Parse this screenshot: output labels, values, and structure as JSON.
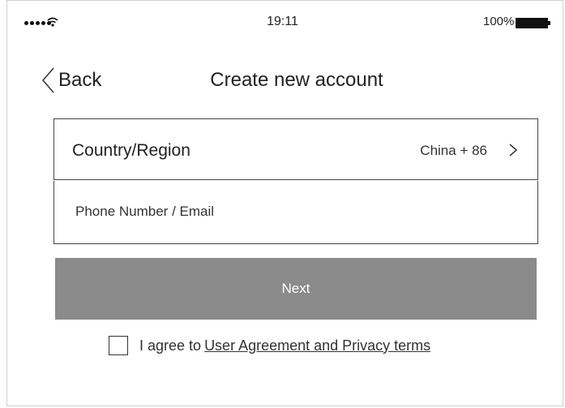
{
  "status_bar": {
    "time": "19:11",
    "battery_percent": "100%",
    "signal_bars": 5
  },
  "nav": {
    "back_label": "Back",
    "title": "Create new account"
  },
  "form": {
    "country_label": "Country/Region",
    "country_value": "China + 86",
    "phone_placeholder": "Phone Number / Email",
    "phone_value": ""
  },
  "next_button": {
    "label": "Next",
    "color": "#8a8a8a"
  },
  "agreement": {
    "checked": false,
    "prefix": "I agree to",
    "link_text": "User Agreement and Privacy terms"
  }
}
